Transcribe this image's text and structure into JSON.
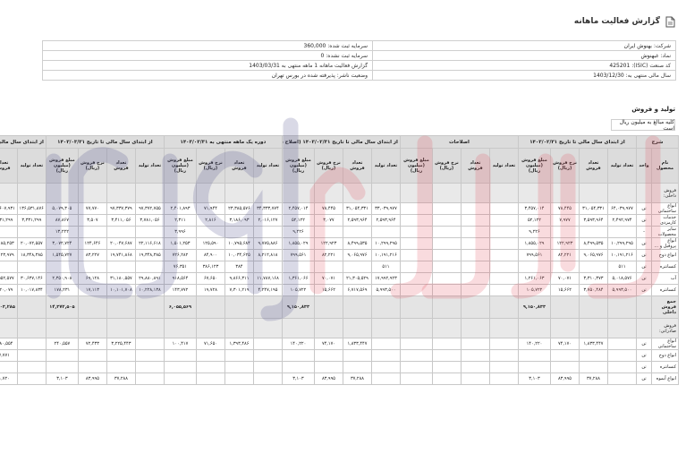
{
  "page": {
    "title": "گزارش فعالیت ماهانه",
    "icon": "document-icon"
  },
  "company_info": {
    "rows": [
      [
        {
          "label": "شرکت:",
          "value": "بهنوش ایران"
        },
        {
          "label": "سرمایه ثبت شده:",
          "value": "360,000"
        }
      ],
      [
        {
          "label": "نماد:",
          "value": "غبهنوش"
        },
        {
          "label": "سرمایه ثبت نشده:",
          "value": "0"
        }
      ],
      [
        {
          "label": "کد صنعت (ISIC):",
          "value": "425201"
        },
        {
          "label": "گزارش فعالیت ماهانه 1 ماهه منتهی به",
          "value": "1403/03/31"
        }
      ],
      [
        {
          "label": "سال مالی منتهی به:",
          "value": "1403/12/30"
        },
        {
          "label": "وضعیت ناشر:",
          "value": "پذیرفته شده در بورس تهران"
        }
      ]
    ]
  },
  "section": {
    "title": "تولید و فروش",
    "unit_note": "کلیه مبالغ به میلیون ریال است"
  },
  "table": {
    "group_headers": {
      "desc": "شرح",
      "g1": "از ابتدای سال مالی تا تاریخ ۱۴۰۳/۰۲/۳۱",
      "g2": "اصلاحات",
      "g3": "از ابتدای سال مالی تا تاریخ ۱۴۰۳/۰۲/۳۱ (اصلاح شده)",
      "g4": "دوره یک ماهه منتهی به ۱۴۰۳/۰۳/۳۱",
      "g5": "از ابتدای سال مالی تا تاریخ ۱۴۰۳/۰۳/۳۱",
      "g6": "از ابتدای سال مالی تا تار"
    },
    "sub_headers": {
      "product": "نام محصول",
      "unit": "واحد",
      "qty_prod": "تعداد تولید",
      "qty_sold": "تعداد فروش",
      "rate": "نرخ فروش (ریال)",
      "amount": "مبلغ فروش (میلیون ریال)"
    },
    "rows": [
      {
        "kind": "grp",
        "label": "فروش داخلی:",
        "unit": "",
        "cells": []
      },
      {
        "kind": "data",
        "label": "انواع ساختمانی",
        "unit": "تن",
        "cells": [
          "۶۴,۰۳۹,۹۷۷",
          "۳۱,۰۵۴,۳۳۱",
          "۷۸,۴۴۵",
          "۳,۴۵۷,۰۱۴",
          "",
          "",
          "",
          "",
          "۳۳,۰۳۹,۹۷۷",
          "۳۱,۰۵۴,۳۳۱",
          "۷۸,۴۴۵",
          "۲,۴۵۷,۰۱۴",
          "۳۴,۳۳۳,۷۷۴",
          "۲۳,۳۸۵,۵۷۶",
          "۷۱,۹۴۴",
          "۲,۴۰۱,۸۹۳",
          "۹۷,۳۷۲,۷۵۵",
          "۹۷,۳۳۷,۳۷۹",
          "۷۷,۷۷۰",
          "۵,۰۷۹,۳۰۵",
          "۱۳۶,۵۳۱,۸۷۶",
          "۱۰۳,۶۰۷,۹۳۱"
        ]
      },
      {
        "kind": "data",
        "label": "خدمات کارمزدی",
        "unit": "تن",
        "cells": [
          "۲,۴۹۲,۹۷۴",
          "۳,۵۹۳,۹۶۴",
          "۷,۹۷۷",
          "۵۲,۱۲۲",
          "",
          "",
          "",
          "",
          "۲,۵۹۳,۹۶۴",
          "۲,۵۹۳,۹۶۴",
          "۳,۰۷۷",
          "۵۲,۱۲۲",
          "۲,۰۱۶,۱۲۷",
          "۳,۱۸۶,۰۹۳",
          "۲,۸۱۶",
          "۲,۳۱۱",
          "۳,۷۸۱,۰۵۶",
          "۳,۴۱۱,۰۵۶",
          "۳,۵۰۷",
          "۸۷,۸۶۷",
          "۳,۳۳۱,۲۹۹",
          "۲,۳۳۱,۲۹۹"
        ]
      },
      {
        "kind": "data",
        "label": "سایر محصولات",
        "unit": "-",
        "cells": [
          "",
          "",
          "",
          "۹,۲۲۶",
          "",
          "",
          "",
          "",
          "",
          "",
          "",
          "۹,۲۲۶",
          "",
          "",
          "",
          "۳,۹۹۶",
          "",
          "",
          "",
          "۱۳,۲۲۲",
          "",
          ""
        ]
      },
      {
        "kind": "data",
        "label": "انواع پروفیل و ...",
        "unit": "تن",
        "cells": [
          "۱۰,۲۹۹,۲۹۵",
          "۸,۴۹۹,۵۳۵",
          "۱۲۲,۹۲۳",
          "۱,۸۵۵,۰۲۹",
          "",
          "",
          "",
          "",
          "۱۰,۲۹۹,۲۹۵",
          "۸,۴۹۹,۵۳۵",
          "۱۲۲,۹۲۳",
          "۱,۸۵۵,۰۲۹",
          "۹,۷۷۵,۸۸۶",
          "۱۰,۷۹۵,۶۸۴",
          "۱۲۵,۵۹۰",
          "۱,۵۰۱,۲۵۳",
          "۲۲,۱۱۶,۶۱۸",
          "۲۰,۰۴۷,۶۸۷",
          "۱۲۴,۶۴۶",
          "۳,۰۷۲,۷۲۴",
          "۲۰,۰۷۲,۵۵۷",
          "۲۱,۱۸۵,۲۵۳"
        ]
      },
      {
        "kind": "data",
        "label": "انواع دوخ",
        "unit": "تن",
        "cells": [
          "۱۰,۱۹۱,۲۱۶",
          "۹,۰۶۵,۹۷۶",
          "۸۲,۲۲۱",
          "۷۹۹,۵۶۱",
          "",
          "",
          "",
          "",
          "۱۰,۱۹۱,۲۱۶",
          "۹,۰۶۵,۹۷۶",
          "۸۲,۲۲۱",
          "۷۹۹,۵۶۱",
          "۸,۲۱۲,۸۱۸",
          "۱۰,۰۳۴,۶۲۵",
          "۸۴,۹۰۰",
          "۷۲۶,۲۸۲",
          "۱۹,۳۴۸,۳۸۵",
          "۱۹,۷۴۱,۸۶۸",
          "۸۳,۲۲۷",
          "۱,۵۴۵,۷۲۷",
          "۱۸,۳۴۸,۳۸۵",
          "۲۰,۱۲۳,۹۷۹"
        ]
      },
      {
        "kind": "data",
        "label": "کنسانتره",
        "unit": "تن",
        "cells": [
          "۵۱۱",
          "",
          "",
          "",
          "",
          "",
          "",
          "",
          "۵۱۱",
          "",
          "",
          "",
          "",
          "۳۸۴",
          "۳۸۶,۱۲۳",
          "۷۶,۳۵۱",
          "",
          "",
          "",
          "",
          "",
          ""
        ]
      },
      {
        "kind": "data",
        "label": "آب",
        "unit": "تن",
        "cells": [
          "۵,۰۱۸,۵۷۶",
          "۳,۳۱۰,۳۷۳",
          "۷۰,۰۷۱",
          "۱,۲۶۱,۰۶۳",
          "",
          "",
          "",
          "",
          "۱۷,۹۹۲,۹۲۳",
          "۲۱,۳۰۵,۵۲۹",
          "۷۰,۰۷۱",
          "۱,۳۶۱,۰۶۶",
          "۱۱,۷۸۷,۱۶۸",
          "۹,۸۶۶,۳۱۱",
          "۶۷,۶۵۰",
          "۹۱۸,۵۶۴",
          "۲۹,۸۸۰,۸۹۱",
          "۳۱,۱۸۰,۵۵۷",
          "۶۹,۱۲۸",
          "۲,۳۵۰,۹۰۸",
          "۳۰,۶۳۷,۱۴۶",
          "۳۲,۵۵۲,۵۷۷"
        ]
      },
      {
        "kind": "data",
        "label": "کنسانتره",
        "unit": "تن",
        "cells": [
          "۵,۹۹۳,۵۰۰",
          "۳,۷۵۰,۴۸۴",
          "۱۵,۶۶۲",
          "۱۰۵,۷۲۲",
          "",
          "",
          "",
          "",
          "۵,۹۹۳,۵۰۰",
          "۶,۷۱۷,۵۶۹",
          "۱۵,۶۶۲",
          "۱۰۵,۷۲۲",
          "۴,۲۴۷,۱۹۵",
          "۷,۳۰۱,۲۱۹",
          "۱۹,۷۲۸",
          "۱۴۳,۷۷۲",
          "۱۰,۲۲۸,۱۳۸",
          "۱۰,۱۰۱,۷۰۸",
          "۱۷,۱۱۳",
          "۱۷۸,۲۳۱",
          "۱۰,۰۱۷,۸۳۴",
          "۹,۲۲۰,۰۷۹"
        ]
      },
      {
        "kind": "tot",
        "label": "جمع فروش داخلی",
        "unit": "",
        "cells": [
          "",
          "",
          "",
          "۹,۱۵۰,۸۳۳",
          "",
          "",
          "",
          "",
          "",
          "",
          "",
          "۹,۱۵۰,۸۳۳",
          "",
          "",
          "",
          "۶,۰۵۵,۵۶۹",
          "",
          "",
          "",
          "۱۴,۳۷۲,۵۰۵",
          "",
          "۳۸۲,۷۰۳,۲۸۵"
        ]
      },
      {
        "kind": "grp",
        "label": "فروش صادراتی:",
        "unit": "",
        "cells": []
      },
      {
        "kind": "data",
        "label": "انواع ساختمانی",
        "unit": "تن",
        "cells": [
          "",
          "۱,۸۳۳,۴۴۷",
          "۷۴,۱۷۰",
          "۱۴۰,۲۲۰",
          "",
          "",
          "",
          "",
          "",
          "۱,۸۳۳,۴۴۷",
          "۷۴,۱۷۰",
          "۱۴۰,۲۲۰",
          "",
          "۱,۳۹۳,۴۸۶",
          "۷۱,۶۵۰",
          "۱۰۰,۴۱۷",
          "",
          "۳,۲۲۵,۴۴۳",
          "۷۲,۴۳۳",
          "۲۴۰,۵۵۷",
          "",
          "۵,۹۸۰,۵۵۴"
        ]
      },
      {
        "kind": "data",
        "label": "انواع دوخ",
        "unit": "تن",
        "cells": [
          "",
          "",
          "",
          "",
          "",
          "",
          "",
          "",
          "",
          "",
          "",
          "",
          "",
          "",
          "",
          "",
          "",
          "",
          "",
          "",
          "",
          "۸۷,۷۷۱"
        ]
      },
      {
        "kind": "data",
        "label": "کنسانتره",
        "unit": "تن",
        "cells": [
          "",
          "",
          "",
          "",
          "",
          "",
          "",
          "",
          "",
          "",
          "",
          "",
          "",
          "",
          "",
          "",
          "",
          "",
          "",
          "",
          "",
          ""
        ]
      },
      {
        "kind": "data",
        "label": "انواع آبموه",
        "unit": "تن",
        "cells": [
          "",
          "۳۷,۲۸۸",
          "۸۳,۹۹۵",
          "۳,۱۰۳",
          "",
          "",
          "",
          "",
          "",
          "۳۷,۲۸۸",
          "۸۳,۹۹۵",
          "۳,۱۰۳",
          "",
          "",
          "",
          "",
          "",
          "۳۷,۲۸۸",
          "۸۳,۹۹۵",
          "۳,۱۰۳",
          "",
          "۵۱,۷۲۰"
        ]
      }
    ]
  },
  "watermark": {
    "text": "اقتصادآنلاین"
  }
}
